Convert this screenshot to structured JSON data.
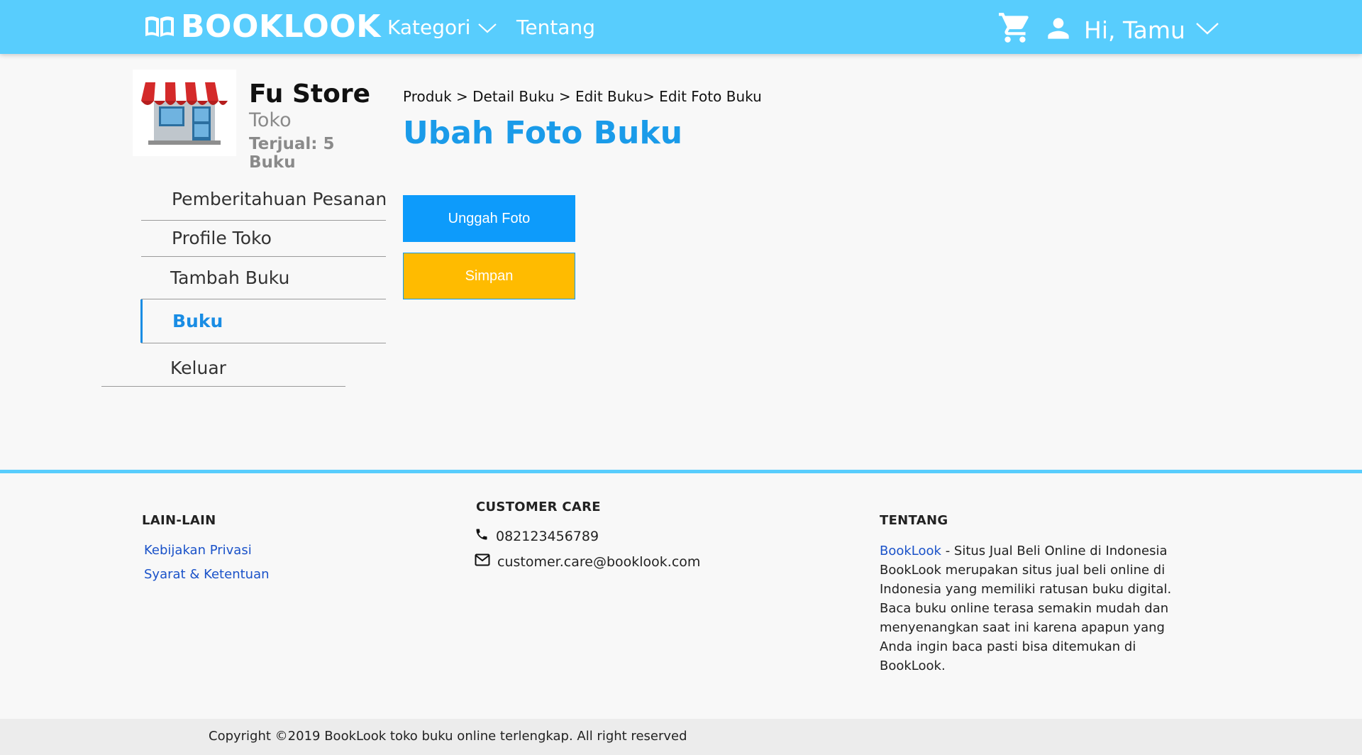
{
  "header": {
    "brand": "BOOKLOOK",
    "nav": [
      {
        "label": "Kategori"
      },
      {
        "label": "Tentang"
      }
    ],
    "greeting": "Hi, Tamu"
  },
  "store": {
    "name": "Fu Store",
    "type": "Toko",
    "sold": "Terjual: 5 Buku"
  },
  "sidebar": {
    "items": [
      {
        "label": "Pemberitahuan Pesanan"
      },
      {
        "label": "Profile Toko"
      },
      {
        "label": "Tambah Buku"
      },
      {
        "label": "Buku"
      },
      {
        "label": "Keluar"
      }
    ],
    "active": "Buku"
  },
  "main": {
    "breadcrumb": "Produk > Detail Buku > Edit Buku> Edit Foto Buku",
    "title": "Ubah Foto Buku",
    "upload_label": "Unggah Foto",
    "save_label": "Simpan"
  },
  "footer": {
    "lain_title": "LAIN-LAIN",
    "links": [
      {
        "label": "Kebijakan Privasi"
      },
      {
        "label": "Syarat & Ketentuan"
      }
    ],
    "care_title": "CUSTOMER CARE",
    "phone": "082123456789",
    "email": "customer.care@booklook.com",
    "about_title": "TENTANG",
    "about_brand": "BookLook",
    "about_text": " - Situs Jual Beli Online di Indonesia BookLook merupakan situs jual beli online di Indonesia yang memiliki ratusan buku digital. Baca buku online terasa semakin mudah dan menyenangkan saat ini karena apapun yang Anda ingin baca pasti bisa ditemukan di BookLook.",
    "copyright": "Copyright ©2019 BookLook toko buku online terlengkap. All right reserved"
  },
  "colors": {
    "header_bg": "#58cdfd",
    "accent_blue": "#1a9be9",
    "upload_btn": "#0d9bfb",
    "save_btn": "#ffbb00",
    "link": "#1a52c9"
  }
}
